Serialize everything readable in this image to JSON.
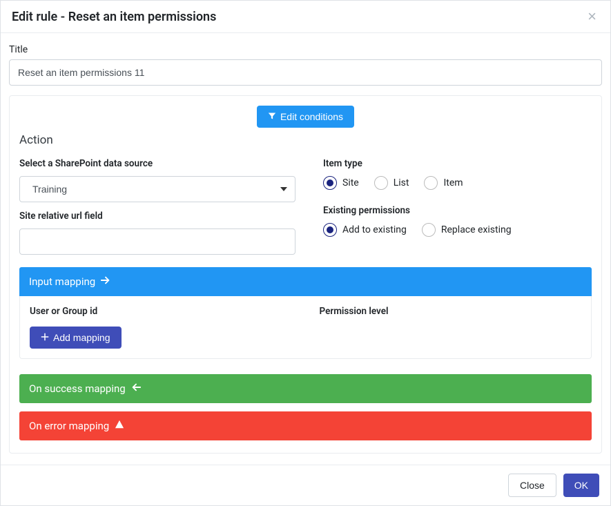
{
  "header": {
    "title": "Edit rule - Reset an item permissions"
  },
  "title_section": {
    "label": "Title",
    "value": "Reset an item permissions 11"
  },
  "edit_conditions_label": "Edit conditions",
  "action": {
    "heading": "Action",
    "source_label": "Select a SharePoint data source",
    "source_value": "Training",
    "site_rel_label": "Site relative url field",
    "site_rel_value": "",
    "item_type": {
      "label": "Item type",
      "options": [
        "Site",
        "List",
        "Item"
      ],
      "selected": "Site"
    },
    "existing_perm": {
      "label": "Existing permissions",
      "options": [
        "Add to existing",
        "Replace existing"
      ],
      "selected": "Add to existing"
    }
  },
  "mappings": {
    "input": {
      "title": "Input mapping",
      "col1": "User or Group id",
      "col2": "Permission level",
      "add_btn": "Add mapping"
    },
    "success": {
      "title": "On success mapping"
    },
    "error": {
      "title": "On error mapping"
    }
  },
  "footer": {
    "close": "Close",
    "ok": "OK"
  }
}
